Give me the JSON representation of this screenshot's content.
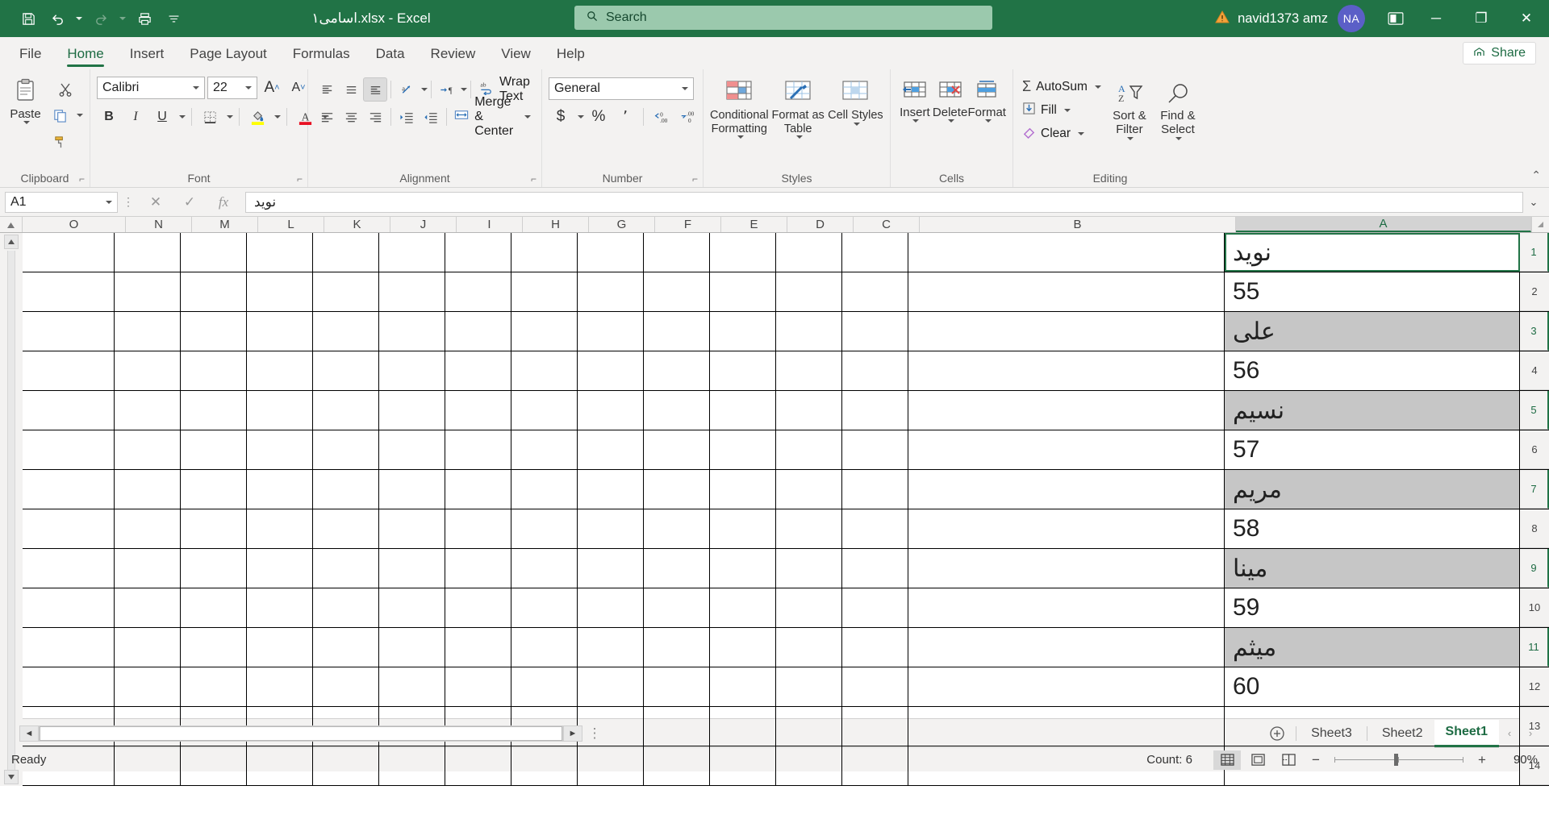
{
  "titlebar": {
    "doc_title": "اسامی۱.xlsx  -  Excel",
    "account_name": "navid1373 amz",
    "avatar_initials": "NA",
    "quick_access": [
      {
        "name": "save-icon",
        "label": "Save"
      },
      {
        "name": "undo-icon",
        "label": "Undo"
      },
      {
        "name": "redo-icon",
        "label": "Redo"
      },
      {
        "name": "print-icon",
        "label": "Print"
      },
      {
        "name": "customize-qat-icon",
        "label": "Customize Quick Access Toolbar"
      }
    ],
    "window_buttons": {
      "minimize": "─",
      "restore": "❐",
      "close": "✕"
    }
  },
  "search": {
    "placeholder": "Search",
    "icon": "search-icon"
  },
  "ribbon_tabs": [
    {
      "label": "File",
      "active": false
    },
    {
      "label": "Home",
      "active": true
    },
    {
      "label": "Insert",
      "active": false
    },
    {
      "label": "Page Layout",
      "active": false
    },
    {
      "label": "Formulas",
      "active": false
    },
    {
      "label": "Data",
      "active": false
    },
    {
      "label": "Review",
      "active": false
    },
    {
      "label": "View",
      "active": false
    },
    {
      "label": "Help",
      "active": false
    }
  ],
  "share": {
    "label": "Share",
    "icon": "share-icon"
  },
  "ribbon": {
    "clipboard": {
      "group_label": "Clipboard",
      "paste_label": "Paste",
      "cut_label": "Cut",
      "copy_label": "Copy",
      "format_painter_label": "Format Painter"
    },
    "font": {
      "group_label": "Font",
      "font_name": "Calibri",
      "font_size": "22",
      "grow_label": "A",
      "shrink_label": "A",
      "bold_label": "B",
      "italic_label": "I",
      "underline_label": "U",
      "borders_label": "Borders",
      "fill_color_label": "Fill Color",
      "font_color_label": "Font Color"
    },
    "alignment": {
      "group_label": "Alignment",
      "wrap_text_label": "Wrap Text",
      "merge_center_label": "Merge & Center",
      "orientation_label": "Orientation",
      "rtl_label": "Text Direction",
      "indent_increase_label": "Increase Indent",
      "indent_decrease_label": "Decrease Indent"
    },
    "number": {
      "group_label": "Number",
      "format": "General",
      "currency_label": "$",
      "percent_label": "%",
      "comma_label": "٬",
      "inc_dec_label": "Increase Decimal",
      "dec_dec_label": "Decrease Decimal"
    },
    "styles": {
      "group_label": "Styles",
      "conditional_formatting_label": "Conditional Formatting",
      "format_as_table_label": "Format as Table",
      "cell_styles_label": "Cell Styles"
    },
    "cells": {
      "group_label": "Cells",
      "insert_label": "Insert",
      "delete_label": "Delete",
      "format_label": "Format"
    },
    "editing": {
      "group_label": "Editing",
      "autosum_label": "AutoSum",
      "fill_label": "Fill",
      "clear_label": "Clear",
      "sort_filter_label": "Sort & Filter",
      "find_select_label": "Find & Select"
    }
  },
  "formula_bar": {
    "name_box": "A1",
    "cancel_icon": "close-icon",
    "enter_icon": "check-icon",
    "function_icon": "fx-icon",
    "value": "نوید"
  },
  "grid": {
    "columns": [
      "O",
      "N",
      "M",
      "L",
      "K",
      "J",
      "I",
      "H",
      "G",
      "F",
      "E",
      "D",
      "C",
      "B",
      "A"
    ],
    "selected_column": "A",
    "rows": [
      {
        "num": "1",
        "value": "نوید",
        "shaded": false,
        "active": true
      },
      {
        "num": "2",
        "value": "55",
        "shaded": false,
        "active": false
      },
      {
        "num": "3",
        "value": "علی",
        "shaded": true,
        "active": false
      },
      {
        "num": "4",
        "value": "56",
        "shaded": false,
        "active": false
      },
      {
        "num": "5",
        "value": "نسیم",
        "shaded": true,
        "active": false
      },
      {
        "num": "6",
        "value": "57",
        "shaded": false,
        "active": false
      },
      {
        "num": "7",
        "value": "مریم",
        "shaded": true,
        "active": false
      },
      {
        "num": "8",
        "value": "58",
        "shaded": false,
        "active": false
      },
      {
        "num": "9",
        "value": "مینا",
        "shaded": true,
        "active": false
      },
      {
        "num": "10",
        "value": "59",
        "shaded": false,
        "active": false
      },
      {
        "num": "11",
        "value": "میثم",
        "shaded": true,
        "active": false
      },
      {
        "num": "12",
        "value": "60",
        "shaded": false,
        "active": false
      },
      {
        "num": "13",
        "value": "",
        "shaded": false,
        "active": false
      },
      {
        "num": "14",
        "value": "",
        "shaded": false,
        "active": false
      }
    ]
  },
  "sheet_tabs": {
    "new_sheet_icon": "plus-circle-icon",
    "tabs": [
      {
        "label": "Sheet3",
        "active": false
      },
      {
        "label": "Sheet2",
        "active": false
      },
      {
        "label": "Sheet1",
        "active": true
      }
    ],
    "nav_prev": "‹",
    "nav_next": "›"
  },
  "status_bar": {
    "mode": "Ready",
    "count": "Count: 6",
    "views": [
      {
        "name": "normal-view-icon",
        "active": true
      },
      {
        "name": "page-layout-view-icon",
        "active": false
      },
      {
        "name": "page-break-view-icon",
        "active": false
      }
    ],
    "zoom_out": "−",
    "zoom_in": "+",
    "zoom_level": "90%"
  },
  "colors": {
    "brand_green": "#217346",
    "search_bg": "#9bc9ad",
    "ribbon_bg": "#f3f2f1",
    "shade_gray": "#c6c6c6",
    "avatar_bg": "#5b5fc7"
  }
}
